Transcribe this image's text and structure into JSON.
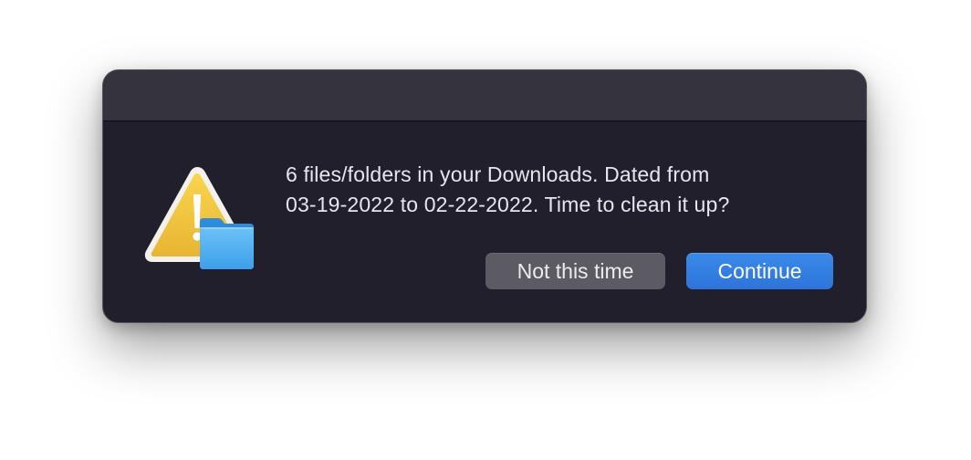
{
  "dialog": {
    "message_line1": "6 files/folders in your Downloads. Dated from",
    "message_line2": "03-19-2022 to 02-22-2022. Time to clean it up?",
    "icon": "warning-triangle-with-folder",
    "buttons": {
      "secondary_label": "Not this time",
      "primary_label": "Continue"
    }
  },
  "colors": {
    "dialog_background": "#201f2b",
    "titlebar_background": "#35333e",
    "secondary_button": "#5c5a63",
    "primary_button": "#2d74da",
    "warning_yellow": "#f3c640",
    "folder_blue": "#3a9be8"
  }
}
